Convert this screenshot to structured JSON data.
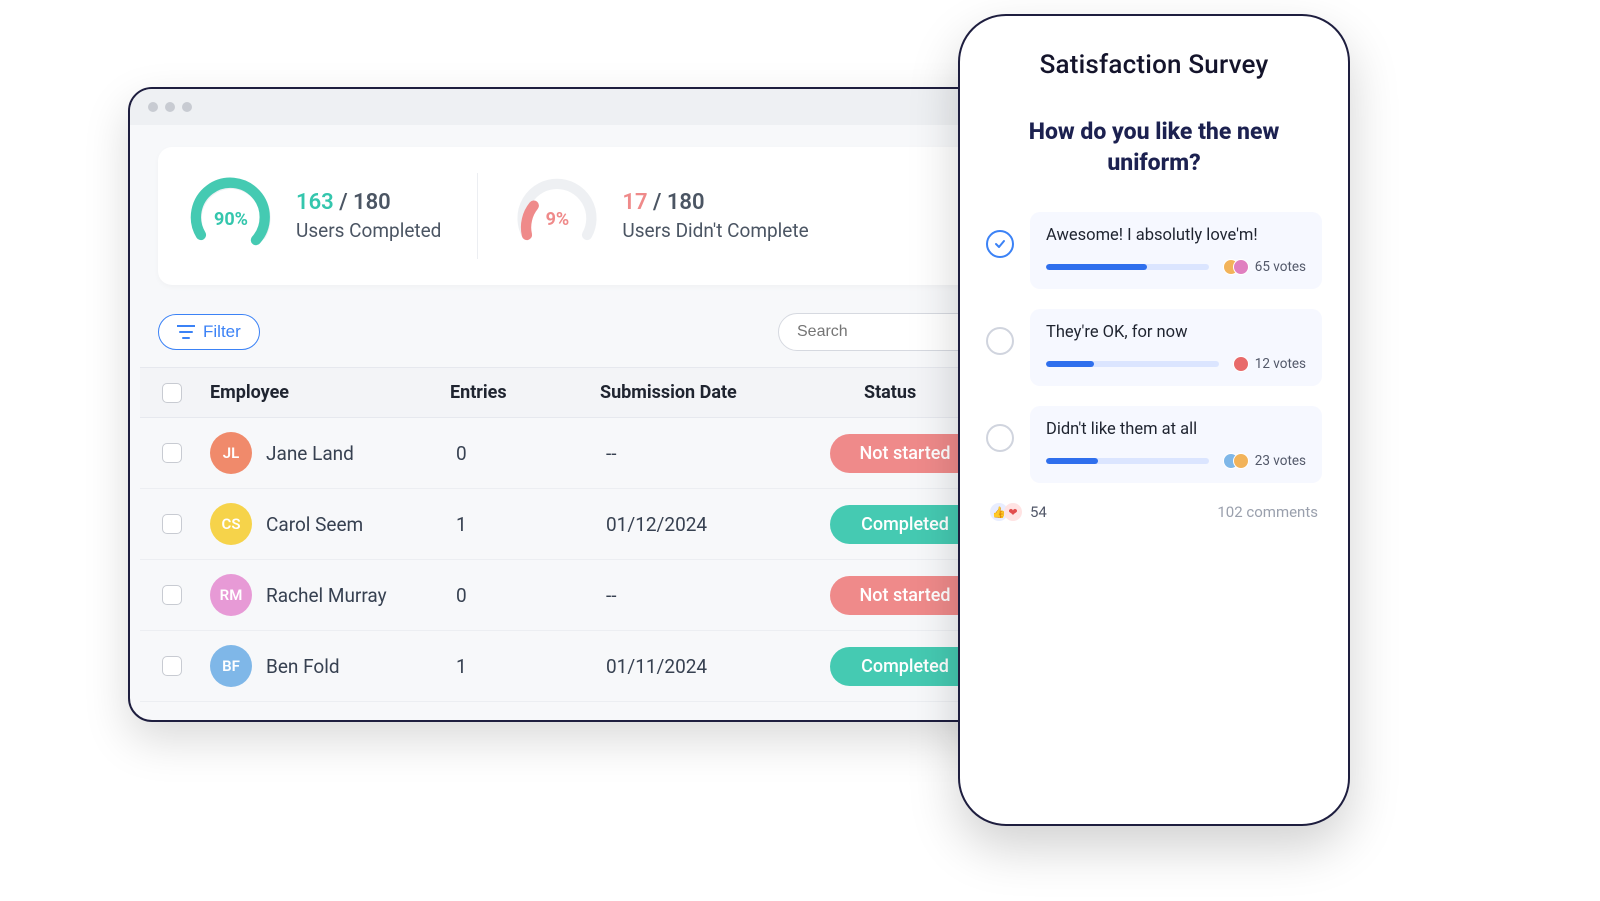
{
  "stats": {
    "completed": {
      "percent": "90%",
      "count": "163",
      "total": "180",
      "caption": "Users Completed"
    },
    "notCompleted": {
      "percent": "9%",
      "count": "17",
      "total": "180",
      "caption": "Users Didn't Complete"
    }
  },
  "controls": {
    "filter_label": "Filter",
    "search_placeholder": "Search"
  },
  "table": {
    "headers": {
      "employee": "Employee",
      "entries": "Entries",
      "submission": "Submission Date",
      "status": "Status"
    },
    "rows": [
      {
        "name": "Jane Land",
        "entries": "0",
        "date": "--",
        "status": "Not started",
        "status_kind": "red",
        "avatar_bg": "#f08a6b"
      },
      {
        "name": "Carol Seem",
        "entries": "1",
        "date": "01/12/2024",
        "status": "Completed",
        "status_kind": "teal",
        "avatar_bg": "#f6d34a"
      },
      {
        "name": "Rachel Murray",
        "entries": "0",
        "date": "--",
        "status": "Not started",
        "status_kind": "red",
        "avatar_bg": "#e79ad6"
      },
      {
        "name": "Ben Fold",
        "entries": "1",
        "date": "01/11/2024",
        "status": "Completed",
        "status_kind": "teal",
        "avatar_bg": "#7fb7e8"
      }
    ]
  },
  "survey": {
    "title": "Satisfaction Survey",
    "question": "How do you like the new uniform?",
    "options": [
      {
        "label": "Awesome! I absolutly love'm!",
        "votes": "65 votes",
        "fill": 62,
        "selected": true,
        "av_colors": [
          "#f2b35a",
          "#e07fc0"
        ]
      },
      {
        "label": "They're OK, for now",
        "votes": "12 votes",
        "fill": 28,
        "selected": false,
        "av_colors": [
          "#e86a6a"
        ]
      },
      {
        "label": "Didn't like them at all",
        "votes": "23 votes",
        "fill": 32,
        "selected": false,
        "av_colors": [
          "#7fb7e8",
          "#f2b35a"
        ]
      }
    ],
    "reactions_count": "54",
    "comments": "102 comments"
  }
}
